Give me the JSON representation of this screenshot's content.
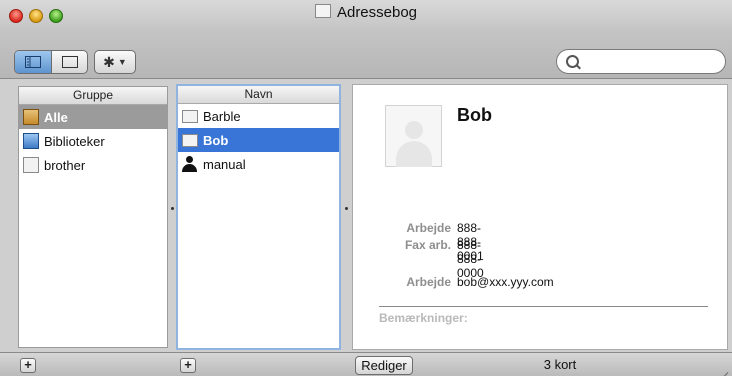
{
  "window": {
    "title": "Adressebog"
  },
  "toolbar": {
    "view_left_icon": "column-view-icon",
    "view_right_icon": "card-view-icon",
    "action_icon": "gear-icon",
    "search": {
      "value": "",
      "placeholder": ""
    }
  },
  "groups": {
    "header": "Gruppe",
    "items": [
      {
        "label": "Alle",
        "icon": "all-contacts-folder-icon",
        "selected": true
      },
      {
        "label": "Biblioteker",
        "icon": "library-folder-icon",
        "selected": false
      },
      {
        "label": "brother",
        "icon": "group-folder-icon",
        "selected": false
      }
    ]
  },
  "names": {
    "header": "Navn",
    "items": [
      {
        "label": "Barble",
        "icon": "contact-card-icon",
        "selected": false
      },
      {
        "label": "Bob",
        "icon": "contact-card-icon",
        "selected": true
      },
      {
        "label": "manual",
        "icon": "person-silhouette-icon",
        "selected": false
      }
    ]
  },
  "card": {
    "name": "Bob",
    "phone_work_label": "Arbejde",
    "phone_work_value": "888-888-0001",
    "fax_label": "Fax arb.",
    "fax_value": "888-888-0000",
    "email_label": "Arbejde",
    "email_value": "bob@xxx.yyy.com",
    "notes_label": "Bemærkninger:"
  },
  "bottombar": {
    "add_group": "+",
    "add_contact": "+",
    "edit_label": "Rediger",
    "count_label": "3 kort"
  },
  "colors": {
    "selection_blue": "#3875d7",
    "selection_grey": "#9b9b9b"
  }
}
